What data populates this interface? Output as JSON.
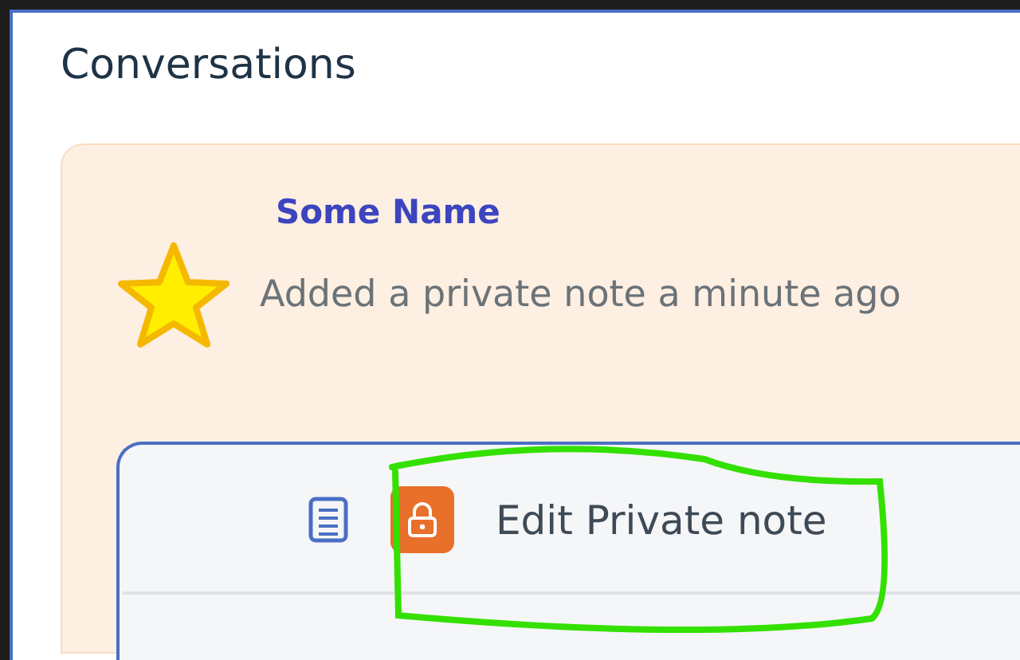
{
  "title": "Conversations",
  "activity": {
    "author": "Some Name",
    "text": "Added a private note a minute ago"
  },
  "note_panel": {
    "label": "Edit Private note"
  }
}
